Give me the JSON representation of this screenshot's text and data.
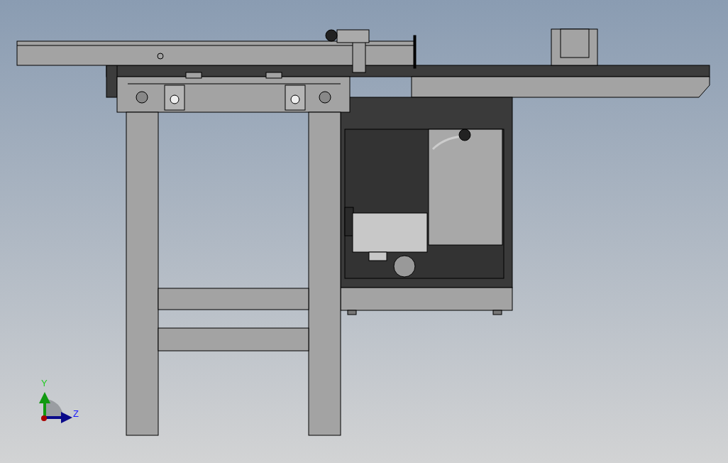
{
  "viewport": {
    "triad": {
      "labels": [
        {
          "text": "Y",
          "color": "#22cc22"
        },
        {
          "text": "Z",
          "color": "#1a1aff"
        }
      ]
    }
  }
}
